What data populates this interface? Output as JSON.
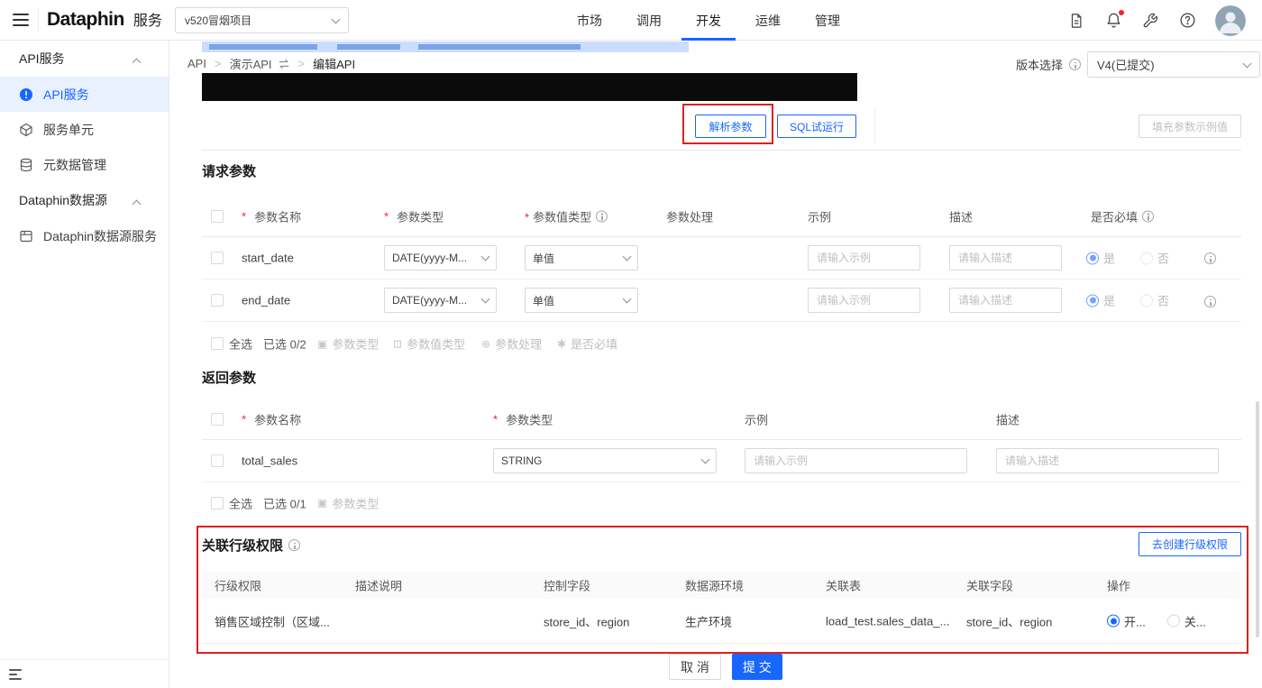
{
  "colors": {
    "primary": "#1966ff",
    "annotation": "#e02020"
  },
  "icons": {
    "param_type": "▣",
    "param_value_type": "⊡",
    "param_handle": "⊕",
    "required_mark": "✱"
  },
  "topbar": {
    "logo_text": "Dataphin",
    "logo_suffix": "服务",
    "project_select": "v520冒烟项目",
    "nav": [
      {
        "label": "市场"
      },
      {
        "label": "调用"
      },
      {
        "label": "开发"
      },
      {
        "label": "运维"
      },
      {
        "label": "管理"
      }
    ]
  },
  "sidebar": {
    "group1_title": "API服务",
    "group1_items": [
      {
        "label": "API服务"
      },
      {
        "label": "服务单元"
      },
      {
        "label": "元数据管理"
      }
    ],
    "group2_title": "Dataphin数据源",
    "group2_items": [
      {
        "label": "Dataphin数据源服务"
      }
    ]
  },
  "breadcrumb": {
    "item1": "API",
    "item2": "演示API",
    "item3": "编辑API",
    "separator": ">"
  },
  "version": {
    "label": "版本选择",
    "value": "V4(已提交)"
  },
  "toolbar": {
    "parse": "解析参数",
    "sql_run": "SQL试运行",
    "fill_example": "填充参数示例值"
  },
  "request_params": {
    "title": "请求参数",
    "headers": {
      "name": "参数名称",
      "type": "参数类型",
      "value_type": "参数值类型",
      "handle": "参数处理",
      "example": "示例",
      "desc": "描述",
      "required": "是否必填"
    },
    "rows": [
      {
        "name": "start_date",
        "type": "DATE(yyyy-M...",
        "value_type": "单值",
        "example_placeholder": "请输入示例",
        "desc_placeholder": "请输入描述",
        "yes": "是",
        "no": "否"
      },
      {
        "name": "end_date",
        "type": "DATE(yyyy-M...",
        "value_type": "单值",
        "example_placeholder": "请输入示例",
        "desc_placeholder": "请输入描述",
        "yes": "是",
        "no": "否"
      }
    ],
    "batch": {
      "select_all": "全选",
      "count": "已选 0/2",
      "action1": "参数类型",
      "action2": "参数值类型",
      "action3": "参数处理",
      "action4": "是否必填"
    }
  },
  "response_params": {
    "title": "返回参数",
    "headers": {
      "name": "参数名称",
      "type": "参数类型",
      "example": "示例",
      "desc": "描述"
    },
    "rows": [
      {
        "name": "total_sales",
        "type": "STRING",
        "example_placeholder": "请输入示例",
        "desc_placeholder": "请输入描述"
      }
    ],
    "batch": {
      "select_all": "全选",
      "count": "已选 0/1",
      "action1": "参数类型"
    }
  },
  "row_permission": {
    "title": "关联行级权限",
    "create_button": "去创建行级权限",
    "headers": {
      "h1": "行级权限",
      "h2": "描述说明",
      "h3": "控制字段",
      "h4": "数据源环境",
      "h5": "关联表",
      "h6": "关联字段",
      "h7": "操作"
    },
    "rows": [
      {
        "name": "销售区域控制（区域...",
        "desc": "",
        "control_field": "store_id、region",
        "env": "生产环境",
        "table": "load_test.sales_data_...",
        "field": "store_id、region",
        "on_label": "开...",
        "off_label": "关..."
      }
    ]
  },
  "footer": {
    "cancel": "取 消",
    "submit": "提 交"
  }
}
